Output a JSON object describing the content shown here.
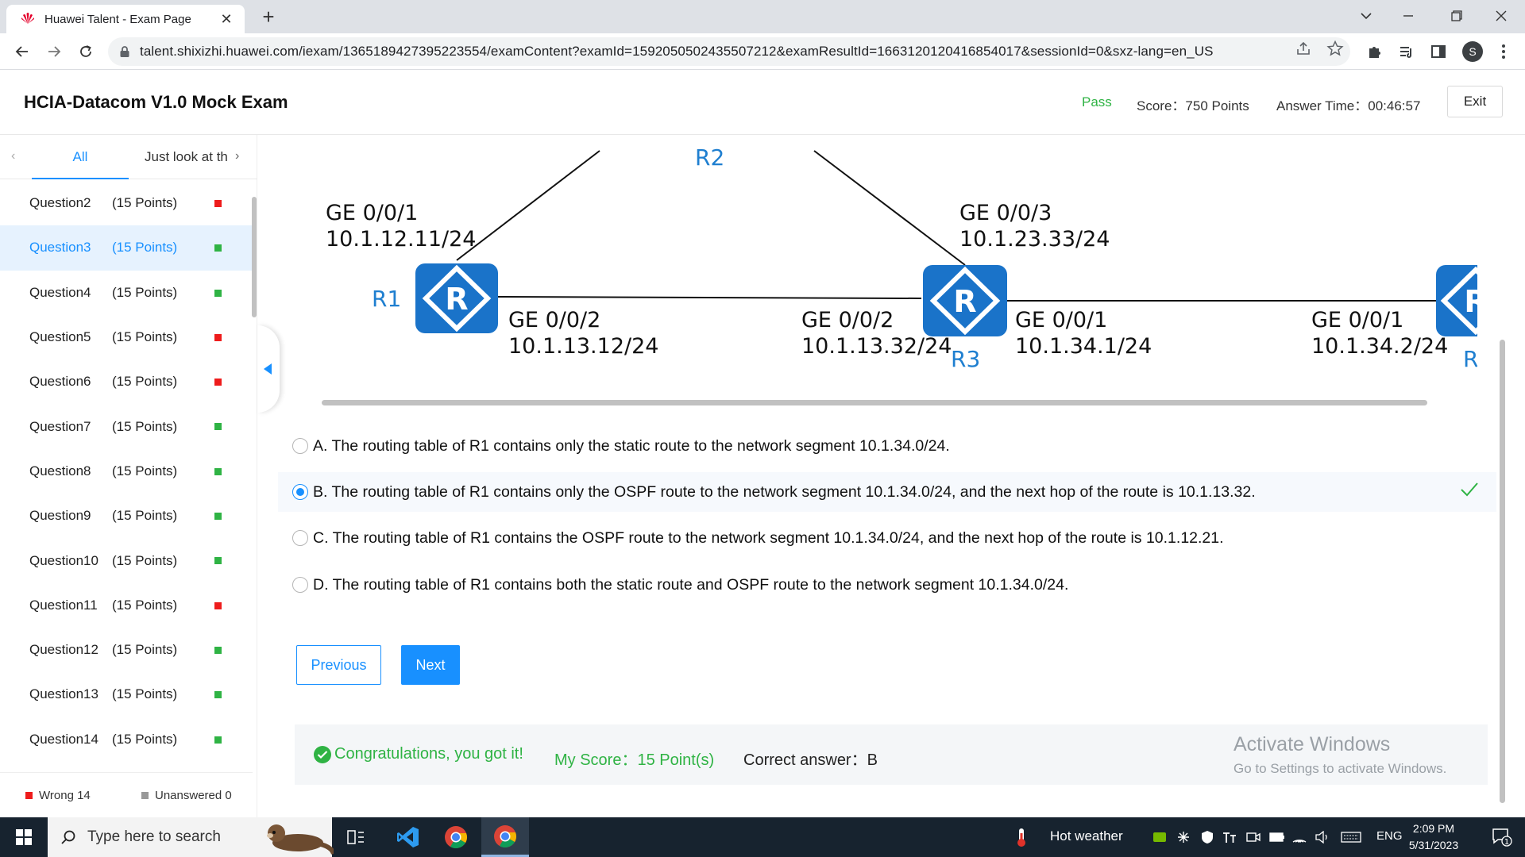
{
  "browser": {
    "tab_title": "Huawei Talent - Exam Page",
    "url": "talent.shixizhi.huawei.com/iexam/1365189427395223554/examContent?examId=1592050502435507212&examResultId=1663120120416854017&sessionId=0&sxz-lang=en_US",
    "profile_initial": "S"
  },
  "header": {
    "title": "HCIA-Datacom V1.0 Mock Exam",
    "status": "Pass",
    "score": "Score：750 Points",
    "answer_time": "Answer Time：00:46:57",
    "exit_label": "Exit"
  },
  "sidebar": {
    "tab_all": "All",
    "tab_look": "Just look at th",
    "questions": [
      {
        "name": "Question2",
        "points": "(15 Points)",
        "status": "wrong",
        "active": false
      },
      {
        "name": "Question3",
        "points": "(15 Points)",
        "status": "right",
        "active": true
      },
      {
        "name": "Question4",
        "points": "(15 Points)",
        "status": "right",
        "active": false
      },
      {
        "name": "Question5",
        "points": "(15 Points)",
        "status": "wrong",
        "active": false
      },
      {
        "name": "Question6",
        "points": "(15 Points)",
        "status": "wrong",
        "active": false
      },
      {
        "name": "Question7",
        "points": "(15 Points)",
        "status": "right",
        "active": false
      },
      {
        "name": "Question8",
        "points": "(15 Points)",
        "status": "right",
        "active": false
      },
      {
        "name": "Question9",
        "points": "(15 Points)",
        "status": "right",
        "active": false
      },
      {
        "name": "Question10",
        "points": "(15 Points)",
        "status": "right",
        "active": false
      },
      {
        "name": "Question11",
        "points": "(15 Points)",
        "status": "wrong",
        "active": false
      },
      {
        "name": "Question12",
        "points": "(15 Points)",
        "status": "right",
        "active": false
      },
      {
        "name": "Question13",
        "points": "(15 Points)",
        "status": "right",
        "active": false
      },
      {
        "name": "Question14",
        "points": "(15 Points)",
        "status": "right",
        "active": false
      }
    ],
    "wrong_label": "Wrong 14",
    "unanswered_label": "Unanswered 0",
    "colors": {
      "wrong": "#ee1c1c",
      "right": "#2fb344",
      "unanswered": "#999999"
    }
  },
  "diagram": {
    "r1": "R1",
    "r2": "R2",
    "r3": "R3",
    "r4_partial": "R",
    "r1_top_if": "GE 0/0/1",
    "r1_top_ip": "10.1.12.11/24",
    "r1_right_if": "GE 0/0/2",
    "r1_right_ip": "10.1.13.12/24",
    "r3_left_if": "GE 0/0/2",
    "r3_left_ip": "10.1.13.32/24",
    "r3_top_if": "GE 0/0/3",
    "r3_top_ip": "10.1.23.33/24",
    "r3_right_if": "GE 0/0/1",
    "r3_right_ip": "10.1.34.1/24",
    "r4_left_if": "GE 0/0/1",
    "r4_left_ip": "10.1.34.2/24",
    "router_color": "#1a73c9"
  },
  "options": [
    {
      "text": "A. The routing table of R1 contains only the static route to the network segment 10.1.34.0/24.",
      "selected": false
    },
    {
      "text": "B. The routing table of R1 contains only the OSPF route to the network segment 10.1.34.0/24, and the next hop of the route is 10.1.13.32.",
      "selected": true
    },
    {
      "text": "C. The routing table of R1 contains the OSPF route to the network segment 10.1.34.0/24, and the next hop of the route is 10.1.12.21.",
      "selected": false
    },
    {
      "text": "D. The routing table of R1 contains both the static route and OSPF route to the network segment 10.1.34.0/24.",
      "selected": false
    }
  ],
  "nav": {
    "previous": "Previous",
    "next": "Next"
  },
  "result": {
    "message": "Congratulations, you got it!",
    "my_score": "My Score：15 Point(s)",
    "correct_answer": "Correct answer：B"
  },
  "watermark": {
    "line1": "Activate Windows",
    "line2": "Go to Settings to activate Windows."
  },
  "taskbar": {
    "search_placeholder": "Type here to search",
    "weather": "Hot weather",
    "lang": "ENG",
    "time": "2:09 PM",
    "date": "5/31/2023",
    "notification_count": "1"
  }
}
